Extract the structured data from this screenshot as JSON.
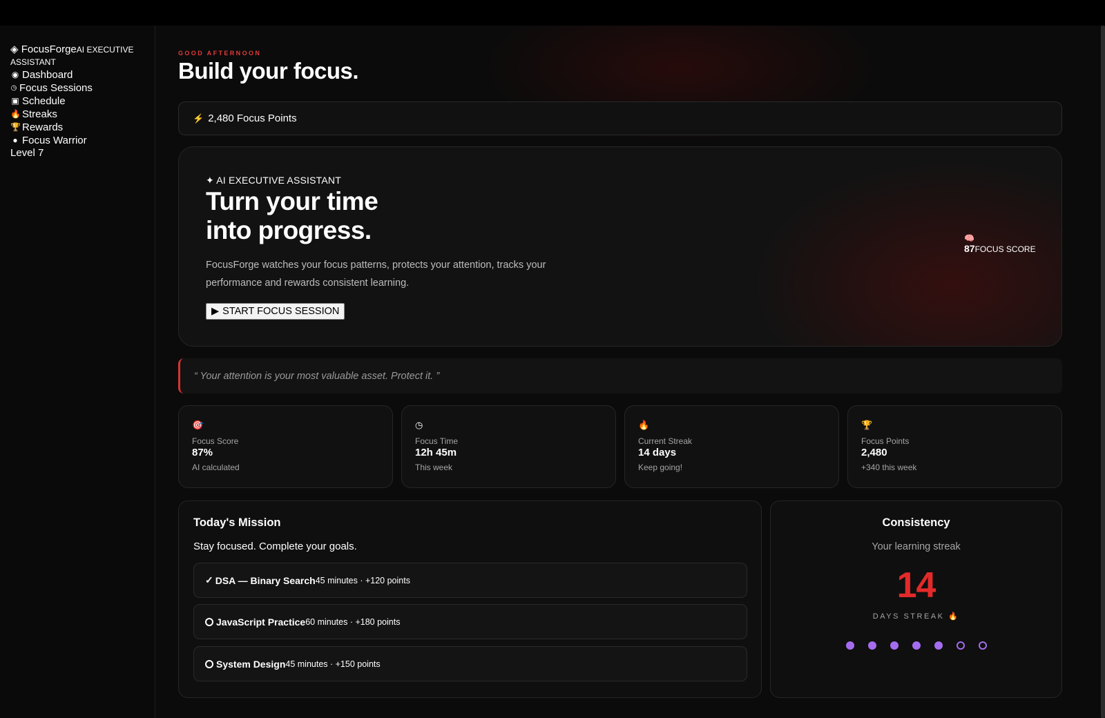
{
  "sidebar": {
    "brand_icon": "diamond-icon",
    "brand_name": "FocusForge",
    "brand_tag": "AI EXECUTIVE ASSISTANT",
    "items": [
      {
        "icon": "◉",
        "icon_name": "dashboard-icon",
        "label": "Dashboard"
      },
      {
        "icon": "◷",
        "icon_name": "clock-icon",
        "label": "Focus Sessions"
      },
      {
        "icon": "▣",
        "icon_name": "calendar-icon",
        "label": "Schedule"
      },
      {
        "icon": "🔥",
        "icon_name": "fire-icon",
        "label": "Streaks"
      },
      {
        "icon": "🏆",
        "icon_name": "trophy-icon",
        "label": "Rewards"
      }
    ],
    "profile": {
      "name": "Focus Warrior",
      "level": "Level 7"
    }
  },
  "header": {
    "greeting": "GOOD AFTERNOON",
    "title": "Build your focus."
  },
  "points_bar": {
    "icon": "⚡",
    "text": "2,480 Focus Points"
  },
  "hero": {
    "eyebrow": "✦ AI EXECUTIVE ASSISTANT",
    "headline_1": "Turn your time",
    "headline_2": "into progress.",
    "description": "FocusForge watches your focus patterns, protects your attention, tracks your performance and rewards consistent learning.",
    "cta_label": "START FOCUS SESSION",
    "score_icon": "🧠",
    "score_value": "87",
    "score_label": "FOCUS SCORE"
  },
  "quote": "“ Your attention is your most valuable asset. Protect it. ”",
  "stats": [
    {
      "icon": "🎯",
      "icon_name": "target-icon",
      "label": "Focus Score",
      "value": "87%",
      "sub": "AI calculated"
    },
    {
      "icon": "◷",
      "icon_name": "clock-icon",
      "label": "Focus Time",
      "value": "12h 45m",
      "sub": "This week"
    },
    {
      "icon": "🔥",
      "icon_name": "fire-icon",
      "label": "Current Streak",
      "value": "14 days",
      "sub": "Keep going!"
    },
    {
      "icon": "🏆",
      "icon_name": "trophy-icon",
      "label": "Focus Points",
      "value": "2,480",
      "sub": "+340 this week"
    }
  ],
  "mission": {
    "title": "Today's Mission",
    "subtitle": "Stay focused. Complete your goals.",
    "tasks": [
      {
        "done": true,
        "name": "DSA — Binary Search",
        "meta": "45 minutes · +120 points"
      },
      {
        "done": false,
        "name": "JavaScript Practice",
        "meta": "60 minutes · +180 points"
      },
      {
        "done": false,
        "name": "System Design",
        "meta": "45 minutes · +150 points"
      }
    ]
  },
  "consistency": {
    "title": "Consistency",
    "subtitle": "Your learning streak",
    "streak": "14",
    "streak_label": "DAYS STREAK 🔥",
    "week": [
      true,
      true,
      true,
      true,
      true,
      false,
      false
    ]
  },
  "colors": {
    "accent_red": "#e32a2a",
    "accent_purple": "#a56cf0",
    "bolt_yellow": "#f5c84b"
  }
}
